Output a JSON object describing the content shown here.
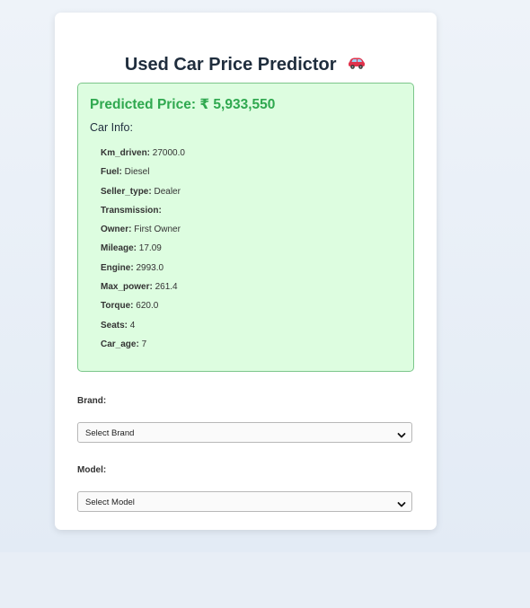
{
  "app": {
    "title": "Used Car Price Predictor",
    "title_icon": "car-icon"
  },
  "result": {
    "price_text": "Predicted Price: ₹ 5,933,550",
    "info_heading": "Car Info:",
    "items": [
      {
        "key": "Km_driven:",
        "value": "27000.0"
      },
      {
        "key": "Fuel:",
        "value": "Diesel"
      },
      {
        "key": "Seller_type:",
        "value": "Dealer"
      },
      {
        "key": "Transmission:",
        "value": ""
      },
      {
        "key": "Owner:",
        "value": "First Owner"
      },
      {
        "key": "Mileage:",
        "value": "17.09"
      },
      {
        "key": "Engine:",
        "value": "2993.0"
      },
      {
        "key": "Max_power:",
        "value": "261.4"
      },
      {
        "key": "Torque:",
        "value": "620.0"
      },
      {
        "key": "Seats:",
        "value": "4"
      },
      {
        "key": "Car_age:",
        "value": "7"
      }
    ]
  },
  "form": {
    "brand_label": "Brand:",
    "brand_selected": "Select Brand",
    "model_label": "Model:",
    "model_selected": "Select Model"
  },
  "colors": {
    "price_green": "#2fa84f",
    "result_bg": "#ddfde0",
    "result_border": "#7bc68a",
    "title_color": "#1f2d3d"
  }
}
